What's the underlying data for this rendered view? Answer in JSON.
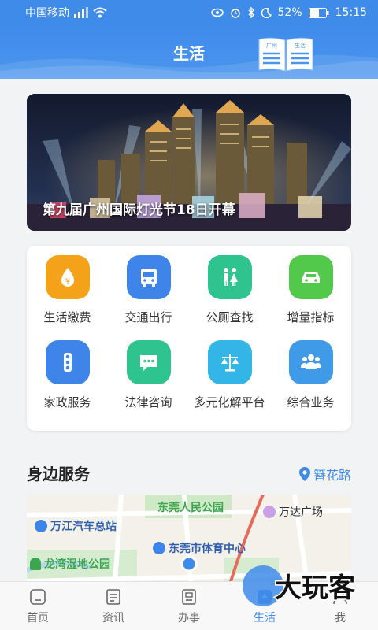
{
  "status_bar": {
    "carrier": "中国移动",
    "battery": "52%",
    "time": "15:15"
  },
  "header": {
    "title": "生活",
    "book_left": "广州",
    "book_right": "生活"
  },
  "banner": {
    "caption": "第九届广州国际灯光节18日开幕"
  },
  "services": [
    {
      "label": "生活缴费",
      "icon": "payment-icon",
      "color": "#f5a21b"
    },
    {
      "label": "交通出行",
      "icon": "bus-icon",
      "color": "#3f84e8"
    },
    {
      "label": "公厕查找",
      "icon": "toilet-icon",
      "color": "#2ec38f"
    },
    {
      "label": "增量指标",
      "icon": "car-icon",
      "color": "#52c94a"
    },
    {
      "label": "家政服务",
      "icon": "traffic-light-icon",
      "color": "#3f84e8"
    },
    {
      "label": "法律咨询",
      "icon": "chat-icon",
      "color": "#2ec38f"
    },
    {
      "label": "多元化解平台",
      "icon": "scales-icon",
      "color": "#33b5e8"
    },
    {
      "label": "综合业务",
      "icon": "people-icon",
      "color": "#3f9ae8"
    }
  ],
  "nearby": {
    "title": "身边服务",
    "location": "簪花路"
  },
  "map": {
    "labels": {
      "park": "东莞人民公园",
      "mall": "万达广场",
      "bus_station": "万江汽车总站",
      "stadium": "东莞市体育中心",
      "wetland": "龙湾湿地公园"
    }
  },
  "bottom_nav": [
    {
      "label": "首页",
      "icon": "home-icon"
    },
    {
      "label": "资讯",
      "icon": "news-icon"
    },
    {
      "label": "办事",
      "icon": "affairs-icon"
    },
    {
      "label": "生活",
      "icon": "life-icon",
      "active": true
    },
    {
      "label": "我",
      "icon": "profile-icon"
    }
  ],
  "watermark": {
    "text": "大玩客"
  }
}
